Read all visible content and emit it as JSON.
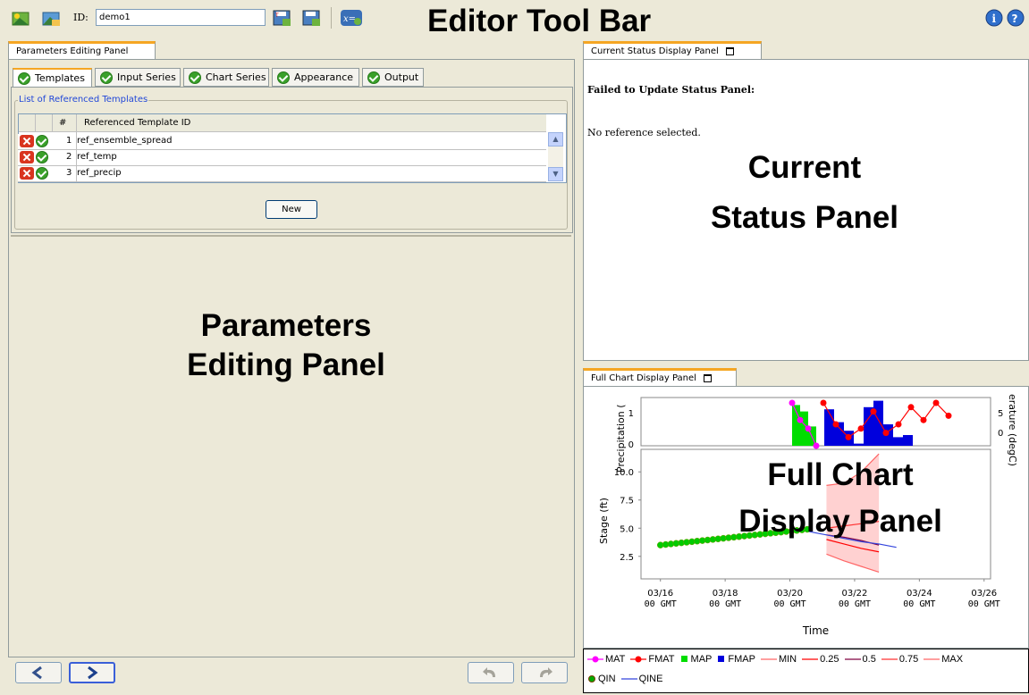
{
  "toolbar": {
    "id_label": "ID:",
    "id_value": "demo1",
    "annotation": "Editor Tool Bar",
    "left_icons": [
      "new-template-icon",
      "open-template-icon"
    ],
    "right_icons": [
      "save-icon",
      "save-as-icon",
      "formula-icon"
    ],
    "help_icons": [
      "info-icon",
      "help-icon"
    ]
  },
  "params_panel": {
    "tab": "Parameters Editing Panel",
    "subtabs": [
      "Templates",
      "Input Series",
      "Chart Series",
      "Appearance",
      "Output"
    ],
    "group_title": "List of Referenced Templates",
    "columns": [
      "#",
      "Referenced Template ID"
    ],
    "rows": [
      {
        "n": "1",
        "id": "ref_ensemble_spread"
      },
      {
        "n": "2",
        "id": "ref_temp"
      },
      {
        "n": "3",
        "id": "ref_precip"
      }
    ],
    "new_button": "New",
    "annotation_line1": "Parameters",
    "annotation_line2": "Editing Panel"
  },
  "status_panel": {
    "tab": "Current Status Display Panel",
    "heading": "Failed to Update Status Panel:",
    "message": "No reference selected.",
    "annotation_line1": "Current",
    "annotation_line2": "Status Panel"
  },
  "chart_panel": {
    "tab": "Full Chart Display Panel",
    "annotation_line1": "Full Chart",
    "annotation_line2": "Display Panel"
  },
  "chart_data": [
    {
      "type": "bar",
      "ylabel": "Precipitation (",
      "y2label": "erature (degC)",
      "yticks": [
        "1",
        "0"
      ],
      "y2ticks": [
        "5",
        "0"
      ],
      "series": [
        {
          "name": "MAT",
          "color": "#ff00ff",
          "values": [
            1.0,
            0.6,
            0.4,
            0.0
          ]
        },
        {
          "name": "FMAT",
          "color": "#ff0000",
          "values": [
            1.0,
            0.5,
            0.2,
            0.4,
            0.8,
            0.3,
            0.5,
            0.9,
            0.6,
            1.0,
            0.7
          ]
        },
        {
          "name": "MAP",
          "color": "#00dd00",
          "values": [
            0.95,
            0.8,
            0.45
          ]
        },
        {
          "name": "FMAP",
          "color": "#0000dd",
          "values": [
            0.85,
            0.55,
            0.35,
            0.05,
            0.9,
            1.05,
            0.5,
            0.2,
            0.25
          ]
        }
      ]
    },
    {
      "type": "line",
      "xlabel": "Time",
      "ylabel": "Stage (ft)",
      "yticks": [
        "10.0",
        "7.5",
        "5.0",
        "2.5"
      ],
      "ylim": [
        0.5,
        12.0
      ],
      "xticks_top": [
        "03/16",
        "03/18",
        "03/20",
        "03/22",
        "03/24",
        "03/26"
      ],
      "xticks_bottom": [
        "00 GMT",
        "00 GMT",
        "00 GMT",
        "00 GMT",
        "00 GMT",
        "00 GMT"
      ],
      "xlim": [
        -0.6,
        10.2
      ],
      "series": [
        {
          "name": "QIN",
          "color": "#00cc00",
          "x": [
            0,
            0.3,
            0.6,
            0.9,
            1.2,
            1.5,
            1.8,
            2.1,
            2.4,
            2.7,
            3.0,
            3.3,
            3.6,
            3.9,
            4.2,
            4.5,
            4.8,
            5.1,
            5.4,
            5.7,
            6.0,
            6.3,
            6.6,
            6.9,
            7.2,
            7.5,
            7.8,
            8.1,
            8.4
          ],
          "y": [
            3.5,
            3.55,
            3.6,
            3.65,
            3.7,
            3.75,
            3.8,
            3.85,
            3.9,
            3.95,
            4.0,
            4.05,
            4.1,
            4.15,
            4.2,
            4.25,
            4.3,
            4.35,
            4.4,
            4.45,
            4.5,
            4.55,
            4.6,
            4.65,
            4.7,
            4.75,
            4.8,
            4.85,
            4.9
          ]
        },
        {
          "name": "QINE",
          "color": "#3344dd",
          "x": [
            8.5,
            9.5,
            10.5,
            11.5,
            12.5,
            13.5
          ],
          "y": [
            4.7,
            4.4,
            4.1,
            3.8,
            3.6,
            3.3
          ]
        },
        {
          "name": "MIN",
          "color": "#ff6666",
          "x": [
            9.5,
            10.5,
            11.5,
            12.5
          ],
          "y": [
            2.7,
            2.1,
            1.6,
            1.1
          ]
        },
        {
          "name": "0.25",
          "color": "#ff0000",
          "x": [
            9.5,
            10.5,
            11.5,
            12.5
          ],
          "y": [
            4.0,
            3.6,
            3.2,
            2.9
          ]
        },
        {
          "name": "0.5",
          "color": "#800040",
          "x": [
            9.5,
            10.5,
            11.5,
            12.5
          ],
          "y": [
            4.4,
            4.2,
            3.9,
            3.5
          ]
        },
        {
          "name": "0.75",
          "color": "#ff3333",
          "x": [
            9.5,
            10.5,
            11.5,
            12.5
          ],
          "y": [
            5.0,
            5.2,
            5.4,
            5.6
          ]
        },
        {
          "name": "MAX",
          "color": "#ff6666",
          "x": [
            9.5,
            10.5,
            11.5,
            12.5
          ],
          "y": [
            8.8,
            9.0,
            10.0,
            11.6
          ]
        }
      ]
    }
  ],
  "legend": {
    "line1": [
      {
        "label": "MAT",
        "color": "#ff00ff",
        "kind": "line-dot"
      },
      {
        "label": "FMAT",
        "color": "#ff0000",
        "kind": "line-dot"
      },
      {
        "label": "MAP",
        "color": "#00dd00",
        "kind": "square"
      },
      {
        "label": "FMAP",
        "color": "#0000dd",
        "kind": "square"
      },
      {
        "label": "MIN",
        "color": "#ff6666",
        "kind": "line"
      },
      {
        "label": "0.25",
        "color": "#ff0000",
        "kind": "line"
      },
      {
        "label": "0.5",
        "color": "#800040",
        "kind": "line"
      },
      {
        "label": "0.75",
        "color": "#ff3333",
        "kind": "line"
      },
      {
        "label": "MAX",
        "color": "#ff6666",
        "kind": "line"
      }
    ],
    "line2": [
      {
        "label": "QIN",
        "color": "#00aa00",
        "kind": "dot"
      },
      {
        "label": "QINE",
        "color": "#3344dd",
        "kind": "line"
      }
    ]
  }
}
